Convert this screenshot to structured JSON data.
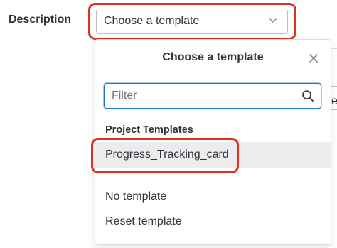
{
  "form": {
    "description_label": "Description"
  },
  "template_select": {
    "value": "Choose a template"
  },
  "dropdown": {
    "title": "Choose a template",
    "filter_placeholder": "Filter",
    "filter_value": "",
    "sections": [
      {
        "header": "Project Templates",
        "items": [
          {
            "label": "Progress_Tracking_card",
            "highlighted": true
          }
        ]
      }
    ],
    "actions": [
      {
        "label": "No template"
      },
      {
        "label": "Reset template"
      }
    ]
  },
  "background": {
    "partial_text": "e"
  },
  "colors": {
    "highlight_outline": "#e0301e",
    "focus_border": "#1f75cb",
    "selected_item_bg": "#ececef",
    "text": "#333238"
  },
  "icons": [
    "chevron-down-icon",
    "close-icon",
    "search-icon"
  ]
}
